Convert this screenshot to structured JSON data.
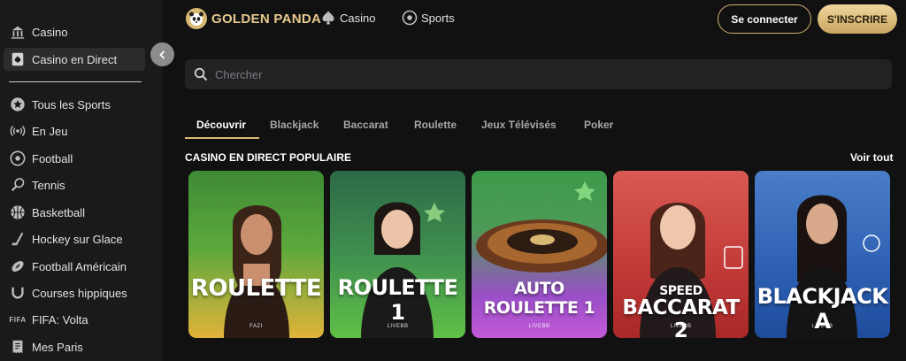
{
  "sidebar": {
    "items": [
      {
        "label": "Casino",
        "icon": "casino-building-icon"
      },
      {
        "label": "Casino en Direct",
        "icon": "card-spade-icon"
      },
      {
        "label": "Tous les Sports",
        "icon": "star-badge-icon"
      },
      {
        "label": "En Jeu",
        "icon": "live-signal-icon"
      },
      {
        "label": "Football",
        "icon": "soccer-ball-icon"
      },
      {
        "label": "Tennis",
        "icon": "tennis-racket-icon"
      },
      {
        "label": "Basketball",
        "icon": "basketball-icon"
      },
      {
        "label": "Hockey sur Glace",
        "icon": "hockey-stick-icon"
      },
      {
        "label": "Football Américain",
        "icon": "american-football-icon"
      },
      {
        "label": "Courses hippiques",
        "icon": "horseshoe-icon"
      },
      {
        "label": "FIFA: Volta",
        "icon_text": "FIFA"
      },
      {
        "label": "Mes Paris",
        "icon": "receipt-icon"
      }
    ]
  },
  "header": {
    "logo_text": "GOLDEN PANDA",
    "nav": [
      {
        "label": "Casino",
        "icon": "spade-icon"
      },
      {
        "label": "Sports",
        "icon": "soccer-ball-icon"
      }
    ],
    "login_label": "Se connecter",
    "signup_label": "S'INSCRIRE"
  },
  "search": {
    "placeholder": "Chercher"
  },
  "tabs": [
    "Découvrir",
    "Blackjack",
    "Baccarat",
    "Roulette",
    "Jeux Télévisés",
    "Poker"
  ],
  "section": {
    "title": "CASINO EN DIRECT POPULAIRE",
    "see_all": "Voir tout"
  },
  "games": [
    {
      "title": "ROULETTE",
      "provider": "FAZI",
      "colors": [
        "#4e9a3c",
        "#e2b23a"
      ]
    },
    {
      "title": "ROULETTE 1",
      "provider": "LIVEBB",
      "colors": [
        "#2f6e4a",
        "#5fc046"
      ]
    },
    {
      "title": "AUTO ROULETTE 1",
      "provider": "LIVEBB",
      "colors": [
        "#3f9a4a",
        "#a84bd0"
      ]
    },
    {
      "title_line1": "SPEED",
      "title_line2": "BACCARAT 2",
      "provider": "LIVEBB",
      "colors": [
        "#d84a45",
        "#b82a2a"
      ]
    },
    {
      "title": "BLACKJACK A",
      "provider": "LIVEBB",
      "colors": [
        "#3f74c4",
        "#1e4fa0"
      ]
    }
  ],
  "colors": {
    "accent_gold": "#d9b874",
    "background": "#111112",
    "sidebar": "#1a1a1b"
  }
}
